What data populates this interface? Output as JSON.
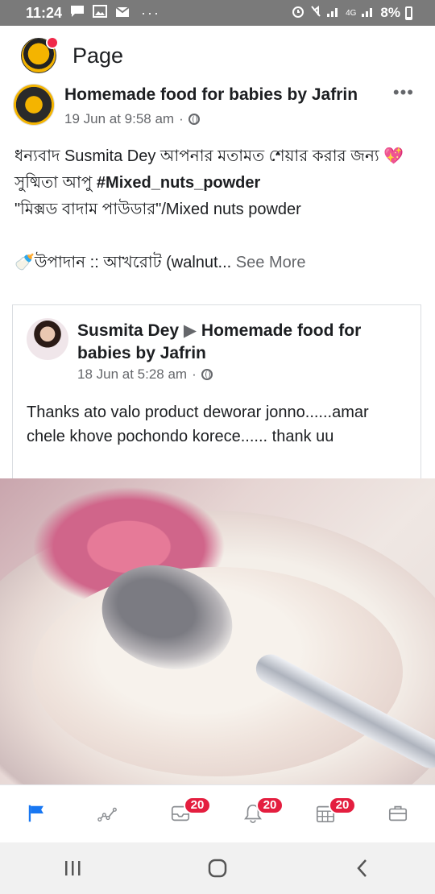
{
  "status_bar": {
    "time": "11:24",
    "notification_icons": [
      "chat-icon",
      "image-icon",
      "mail-icon",
      "more-icon"
    ],
    "network_label": "4G",
    "battery": "8%"
  },
  "app_bar": {
    "title": "Page"
  },
  "post": {
    "author": "Homemade food for babies by Jafrin",
    "timestamp": "19 Jun at 9:58 am",
    "more_label": "•••",
    "text_line1_prefix": "ধন্যবাদ ",
    "text_line1_name": "Susmita Dey",
    "text_line1_suffix": " আপনার মতামত শেয়ার করার জন্য ",
    "heart": "💖",
    "text_line2_prefix": "সুষ্মিতা আপু ",
    "hashtag": "#Mixed_nuts_powder",
    "text_line3": "\"মিক্সড বাদাম পাউডার\"/Mixed nuts powder",
    "text_line4": "উপাদান :: আখরোট (walnut...",
    "bottle": "🍼",
    "see_more": "See More"
  },
  "shared_post": {
    "author": "Susmita Dey",
    "arrow": "▶",
    "target": "Homemade food for babies by Jafrin",
    "timestamp": "18 Jun at 5:28 am",
    "text": "Thanks  ato valo product  deworar jonno......amar chele khove pochondo korece...... thank  uu"
  },
  "tab_bar": {
    "tabs": [
      {
        "name": "flag-icon",
        "badge": ""
      },
      {
        "name": "insights-icon",
        "badge": ""
      },
      {
        "name": "inbox-icon",
        "badge": "20"
      },
      {
        "name": "bell-icon",
        "badge": "20"
      },
      {
        "name": "calendar-icon",
        "badge": "20"
      },
      {
        "name": "briefcase-icon",
        "badge": ""
      }
    ],
    "active_color": "#1877f2",
    "inactive_color": "#8a8d91"
  },
  "nav_bar": {
    "recents": "|||",
    "back": "‹"
  }
}
